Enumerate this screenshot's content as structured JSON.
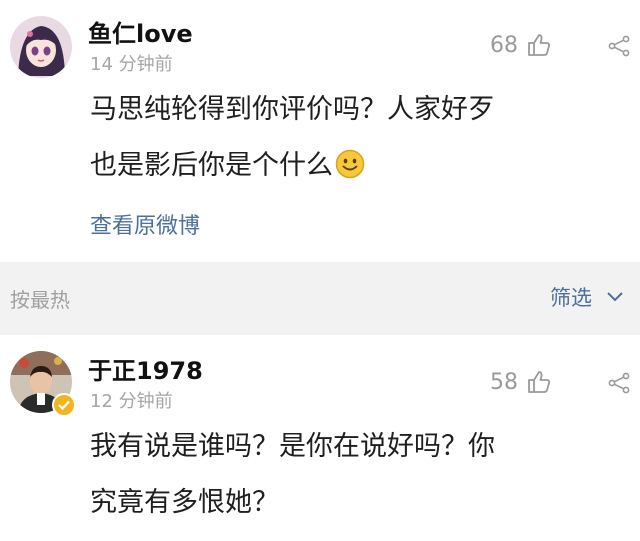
{
  "comments": [
    {
      "username": "鱼仁love",
      "time": "14 分钟前",
      "likes": "68",
      "text_line1": "马思纯轮得到你评价吗？人家好歹",
      "text_line2": "也是影后你是个什么",
      "view_original": "查看原微博",
      "emoji": "smile-emoji"
    },
    {
      "username": "于正1978",
      "time": "12 分钟前",
      "likes": "58",
      "text_line1": "我有说是谁吗？是你在说好吗？你",
      "text_line2": "究竟有多恨她？"
    }
  ],
  "sort_bar": {
    "sort_label": "按最热",
    "filter_label": "筛选"
  },
  "colors": {
    "link": "#4d6f9c",
    "muted": "#a6a6a6",
    "bar_bg": "#f2f2f2"
  },
  "icons": [
    "like-thumb-icon",
    "share-icon",
    "chevron-down-icon",
    "verified-badge-icon"
  ]
}
